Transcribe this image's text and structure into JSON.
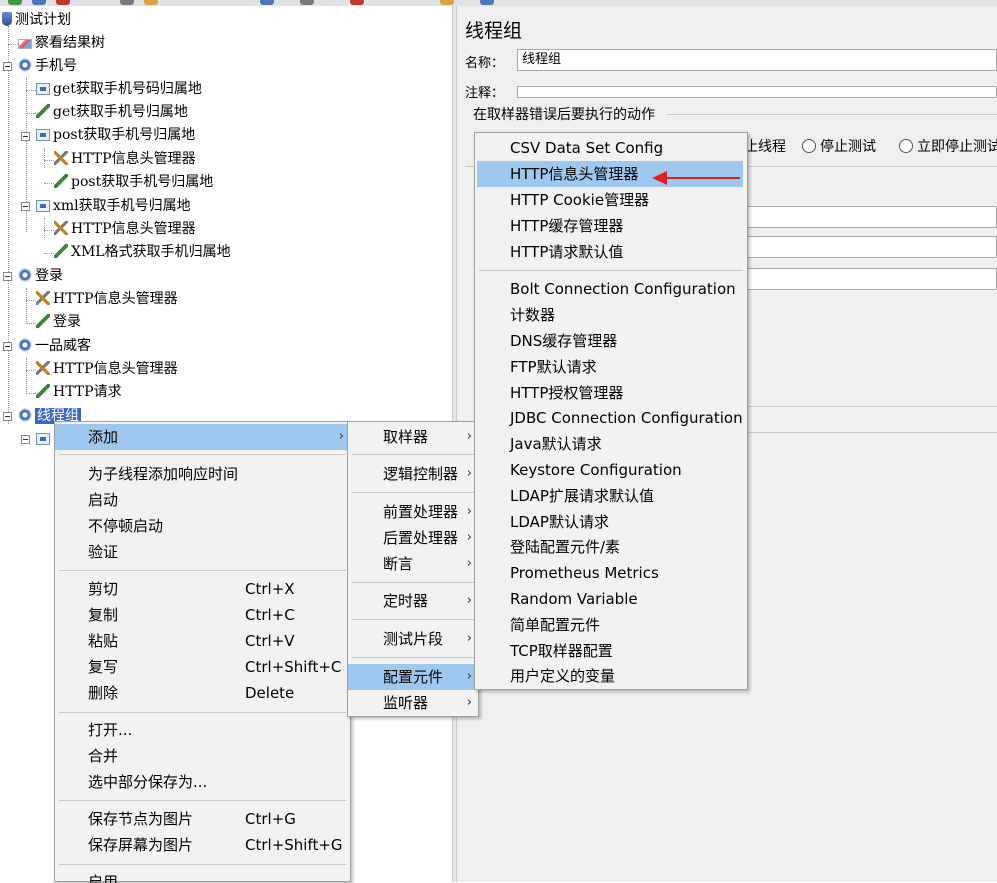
{
  "tree": {
    "nodes": [
      {
        "label": "测试计划",
        "icon": "test-plan-icon"
      },
      {
        "label": "察看结果树",
        "icon": "view-results-tree-icon"
      },
      {
        "label": "手机号",
        "icon": "thread-group-gear-icon"
      },
      {
        "label": "get获取手机号码归属地",
        "icon": "http-sampler-icon"
      },
      {
        "label": "get获取手机号归属地",
        "icon": "pen-sampler-icon"
      },
      {
        "label": "post获取手机号归属地",
        "icon": "http-sampler-icon"
      },
      {
        "label": "HTTP信息头管理器",
        "icon": "config-tool-icon"
      },
      {
        "label": "post获取手机号归属地",
        "icon": "pen-sampler-icon"
      },
      {
        "label": "xml获取手机号归属地",
        "icon": "http-sampler-icon"
      },
      {
        "label": "HTTP信息头管理器",
        "icon": "config-tool-icon"
      },
      {
        "label": "XML格式获取手机归属地",
        "icon": "pen-sampler-icon"
      },
      {
        "label": "登录",
        "icon": "thread-group-gear-icon"
      },
      {
        "label": "HTTP信息头管理器",
        "icon": "config-tool-icon"
      },
      {
        "label": "登录",
        "icon": "pen-sampler-icon"
      },
      {
        "label": "一品威客",
        "icon": "thread-group-gear-icon"
      },
      {
        "label": "HTTP信息头管理器",
        "icon": "config-tool-icon"
      },
      {
        "label": "HTTP请求",
        "icon": "pen-sampler-icon"
      },
      {
        "label": "线程组",
        "icon": "thread-group-gear-icon"
      }
    ]
  },
  "right_panel": {
    "title": "线程组",
    "name_label": "名称：",
    "name_value": "线程组",
    "comment_label": "注释：",
    "comment_value": "",
    "error_section_title": "在取样器错误后要执行的动作",
    "radio_stop_thread": "止线程",
    "radio_stop_test": "停止测试",
    "radio_stop_now": "立即停止测试"
  },
  "context_menu": {
    "items": [
      {
        "label": "添加",
        "shortcut": "",
        "submenu": true
      },
      {
        "label": "为子线程添加响应时间",
        "shortcut": ""
      },
      {
        "label": "启动",
        "shortcut": ""
      },
      {
        "label": "不停顿启动",
        "shortcut": ""
      },
      {
        "label": "验证",
        "shortcut": ""
      },
      {
        "label": "剪切",
        "shortcut": "Ctrl+X"
      },
      {
        "label": "复制",
        "shortcut": "Ctrl+C"
      },
      {
        "label": "粘贴",
        "shortcut": "Ctrl+V"
      },
      {
        "label": "复写",
        "shortcut": "Ctrl+Shift+C"
      },
      {
        "label": "删除",
        "shortcut": "Delete"
      },
      {
        "label": "打开...",
        "shortcut": ""
      },
      {
        "label": "合并",
        "shortcut": ""
      },
      {
        "label": "选中部分保存为...",
        "shortcut": ""
      },
      {
        "label": "保存节点为图片",
        "shortcut": "Ctrl+G"
      },
      {
        "label": "保存屏幕为图片",
        "shortcut": "Ctrl+Shift+G"
      },
      {
        "label": "启用",
        "shortcut": ""
      }
    ]
  },
  "add_submenu": {
    "items": [
      {
        "label": "取样器"
      },
      {
        "label": "逻辑控制器"
      },
      {
        "label": "前置处理器"
      },
      {
        "label": "后置处理器"
      },
      {
        "label": "断言"
      },
      {
        "label": "定时器"
      },
      {
        "label": "测试片段"
      },
      {
        "label": "配置元件"
      },
      {
        "label": "监听器"
      }
    ]
  },
  "config_submenu": {
    "items": [
      {
        "label": "CSV Data Set Config"
      },
      {
        "label": "HTTP信息头管理器"
      },
      {
        "label": "HTTP Cookie管理器"
      },
      {
        "label": "HTTP缓存管理器"
      },
      {
        "label": "HTTP请求默认值"
      },
      {
        "label": "Bolt Connection Configuration"
      },
      {
        "label": "计数器"
      },
      {
        "label": "DNS缓存管理器"
      },
      {
        "label": "FTP默认请求"
      },
      {
        "label": "HTTP授权管理器"
      },
      {
        "label": "JDBC Connection Configuration"
      },
      {
        "label": "Java默认请求"
      },
      {
        "label": "Keystore Configuration"
      },
      {
        "label": "LDAP扩展请求默认值"
      },
      {
        "label": "LDAP默认请求"
      },
      {
        "label": "登陆配置元件/素"
      },
      {
        "label": "Prometheus Metrics"
      },
      {
        "label": "Random Variable"
      },
      {
        "label": "简单配置元件"
      },
      {
        "label": "TCP取样器配置"
      },
      {
        "label": "用户定义的变量"
      }
    ]
  },
  "colors": {
    "selection": "#3a67c6",
    "menu_highlight": "#9ec8f0",
    "annotation_arrow": "#e02020"
  }
}
